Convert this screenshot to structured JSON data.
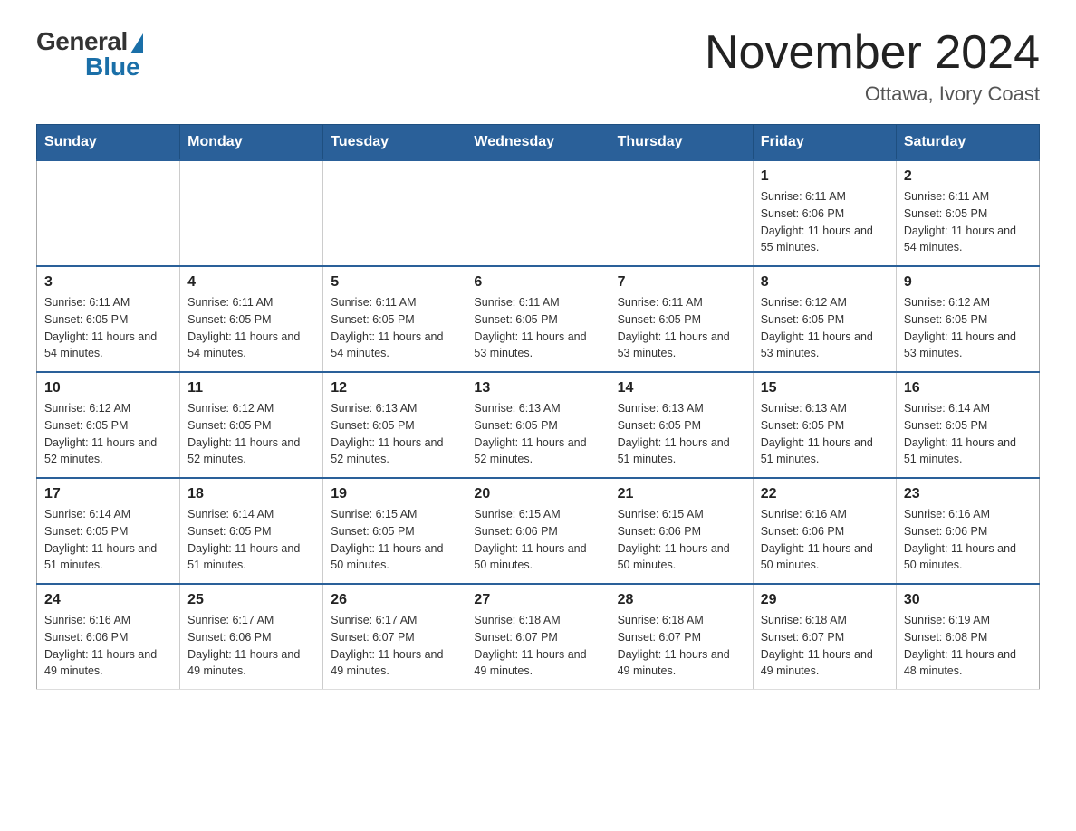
{
  "header": {
    "logo_general": "General",
    "logo_blue": "Blue",
    "month_title": "November 2024",
    "location": "Ottawa, Ivory Coast"
  },
  "days_of_week": [
    "Sunday",
    "Monday",
    "Tuesday",
    "Wednesday",
    "Thursday",
    "Friday",
    "Saturday"
  ],
  "weeks": [
    [
      {
        "day": "",
        "sunrise": "",
        "sunset": "",
        "daylight": "",
        "empty": true
      },
      {
        "day": "",
        "sunrise": "",
        "sunset": "",
        "daylight": "",
        "empty": true
      },
      {
        "day": "",
        "sunrise": "",
        "sunset": "",
        "daylight": "",
        "empty": true
      },
      {
        "day": "",
        "sunrise": "",
        "sunset": "",
        "daylight": "",
        "empty": true
      },
      {
        "day": "",
        "sunrise": "",
        "sunset": "",
        "daylight": "",
        "empty": true
      },
      {
        "day": "1",
        "sunrise": "Sunrise: 6:11 AM",
        "sunset": "Sunset: 6:06 PM",
        "daylight": "Daylight: 11 hours and 55 minutes.",
        "empty": false
      },
      {
        "day": "2",
        "sunrise": "Sunrise: 6:11 AM",
        "sunset": "Sunset: 6:05 PM",
        "daylight": "Daylight: 11 hours and 54 minutes.",
        "empty": false
      }
    ],
    [
      {
        "day": "3",
        "sunrise": "Sunrise: 6:11 AM",
        "sunset": "Sunset: 6:05 PM",
        "daylight": "Daylight: 11 hours and 54 minutes.",
        "empty": false
      },
      {
        "day": "4",
        "sunrise": "Sunrise: 6:11 AM",
        "sunset": "Sunset: 6:05 PM",
        "daylight": "Daylight: 11 hours and 54 minutes.",
        "empty": false
      },
      {
        "day": "5",
        "sunrise": "Sunrise: 6:11 AM",
        "sunset": "Sunset: 6:05 PM",
        "daylight": "Daylight: 11 hours and 54 minutes.",
        "empty": false
      },
      {
        "day": "6",
        "sunrise": "Sunrise: 6:11 AM",
        "sunset": "Sunset: 6:05 PM",
        "daylight": "Daylight: 11 hours and 53 minutes.",
        "empty": false
      },
      {
        "day": "7",
        "sunrise": "Sunrise: 6:11 AM",
        "sunset": "Sunset: 6:05 PM",
        "daylight": "Daylight: 11 hours and 53 minutes.",
        "empty": false
      },
      {
        "day": "8",
        "sunrise": "Sunrise: 6:12 AM",
        "sunset": "Sunset: 6:05 PM",
        "daylight": "Daylight: 11 hours and 53 minutes.",
        "empty": false
      },
      {
        "day": "9",
        "sunrise": "Sunrise: 6:12 AM",
        "sunset": "Sunset: 6:05 PM",
        "daylight": "Daylight: 11 hours and 53 minutes.",
        "empty": false
      }
    ],
    [
      {
        "day": "10",
        "sunrise": "Sunrise: 6:12 AM",
        "sunset": "Sunset: 6:05 PM",
        "daylight": "Daylight: 11 hours and 52 minutes.",
        "empty": false
      },
      {
        "day": "11",
        "sunrise": "Sunrise: 6:12 AM",
        "sunset": "Sunset: 6:05 PM",
        "daylight": "Daylight: 11 hours and 52 minutes.",
        "empty": false
      },
      {
        "day": "12",
        "sunrise": "Sunrise: 6:13 AM",
        "sunset": "Sunset: 6:05 PM",
        "daylight": "Daylight: 11 hours and 52 minutes.",
        "empty": false
      },
      {
        "day": "13",
        "sunrise": "Sunrise: 6:13 AM",
        "sunset": "Sunset: 6:05 PM",
        "daylight": "Daylight: 11 hours and 52 minutes.",
        "empty": false
      },
      {
        "day": "14",
        "sunrise": "Sunrise: 6:13 AM",
        "sunset": "Sunset: 6:05 PM",
        "daylight": "Daylight: 11 hours and 51 minutes.",
        "empty": false
      },
      {
        "day": "15",
        "sunrise": "Sunrise: 6:13 AM",
        "sunset": "Sunset: 6:05 PM",
        "daylight": "Daylight: 11 hours and 51 minutes.",
        "empty": false
      },
      {
        "day": "16",
        "sunrise": "Sunrise: 6:14 AM",
        "sunset": "Sunset: 6:05 PM",
        "daylight": "Daylight: 11 hours and 51 minutes.",
        "empty": false
      }
    ],
    [
      {
        "day": "17",
        "sunrise": "Sunrise: 6:14 AM",
        "sunset": "Sunset: 6:05 PM",
        "daylight": "Daylight: 11 hours and 51 minutes.",
        "empty": false
      },
      {
        "day": "18",
        "sunrise": "Sunrise: 6:14 AM",
        "sunset": "Sunset: 6:05 PM",
        "daylight": "Daylight: 11 hours and 51 minutes.",
        "empty": false
      },
      {
        "day": "19",
        "sunrise": "Sunrise: 6:15 AM",
        "sunset": "Sunset: 6:05 PM",
        "daylight": "Daylight: 11 hours and 50 minutes.",
        "empty": false
      },
      {
        "day": "20",
        "sunrise": "Sunrise: 6:15 AM",
        "sunset": "Sunset: 6:06 PM",
        "daylight": "Daylight: 11 hours and 50 minutes.",
        "empty": false
      },
      {
        "day": "21",
        "sunrise": "Sunrise: 6:15 AM",
        "sunset": "Sunset: 6:06 PM",
        "daylight": "Daylight: 11 hours and 50 minutes.",
        "empty": false
      },
      {
        "day": "22",
        "sunrise": "Sunrise: 6:16 AM",
        "sunset": "Sunset: 6:06 PM",
        "daylight": "Daylight: 11 hours and 50 minutes.",
        "empty": false
      },
      {
        "day": "23",
        "sunrise": "Sunrise: 6:16 AM",
        "sunset": "Sunset: 6:06 PM",
        "daylight": "Daylight: 11 hours and 50 minutes.",
        "empty": false
      }
    ],
    [
      {
        "day": "24",
        "sunrise": "Sunrise: 6:16 AM",
        "sunset": "Sunset: 6:06 PM",
        "daylight": "Daylight: 11 hours and 49 minutes.",
        "empty": false
      },
      {
        "day": "25",
        "sunrise": "Sunrise: 6:17 AM",
        "sunset": "Sunset: 6:06 PM",
        "daylight": "Daylight: 11 hours and 49 minutes.",
        "empty": false
      },
      {
        "day": "26",
        "sunrise": "Sunrise: 6:17 AM",
        "sunset": "Sunset: 6:07 PM",
        "daylight": "Daylight: 11 hours and 49 minutes.",
        "empty": false
      },
      {
        "day": "27",
        "sunrise": "Sunrise: 6:18 AM",
        "sunset": "Sunset: 6:07 PM",
        "daylight": "Daylight: 11 hours and 49 minutes.",
        "empty": false
      },
      {
        "day": "28",
        "sunrise": "Sunrise: 6:18 AM",
        "sunset": "Sunset: 6:07 PM",
        "daylight": "Daylight: 11 hours and 49 minutes.",
        "empty": false
      },
      {
        "day": "29",
        "sunrise": "Sunrise: 6:18 AM",
        "sunset": "Sunset: 6:07 PM",
        "daylight": "Daylight: 11 hours and 49 minutes.",
        "empty": false
      },
      {
        "day": "30",
        "sunrise": "Sunrise: 6:19 AM",
        "sunset": "Sunset: 6:08 PM",
        "daylight": "Daylight: 11 hours and 48 minutes.",
        "empty": false
      }
    ]
  ]
}
